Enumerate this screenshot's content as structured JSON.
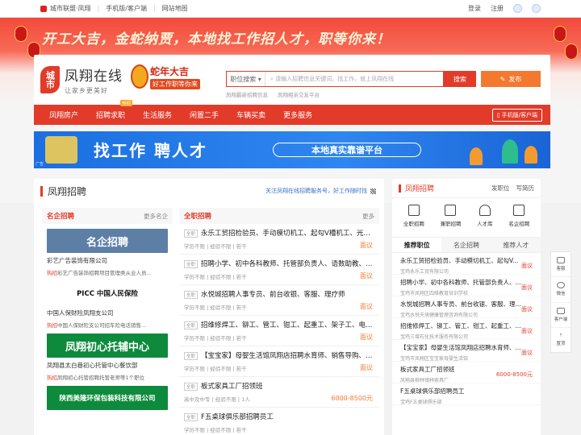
{
  "topbar": {
    "site_name": "城市联盟·凤翔",
    "mobile": "手机版/客户端",
    "sitemap": "网站地图",
    "login": "登录",
    "register": "注册"
  },
  "banner": {
    "slogan": "开工大吉，金蛇纳贾，本地找工作招人才，职等你来！"
  },
  "brand": {
    "badge": "城市",
    "name": "凤翔在线",
    "tagline": "让家乡更美好"
  },
  "snake": {
    "title": "蛇年大吉",
    "subtitle": "好工作职等你来"
  },
  "search": {
    "category": "职位搜索",
    "placeholder": "请输入招聘信息关键词，找工作，就上凤翔在线",
    "button": "搜索",
    "post_button": "发布",
    "hot": [
      "凤翔最新招聘信息",
      "凤翔相亲交友平台"
    ]
  },
  "nav": {
    "items": [
      "凤翔房产",
      "招聘求职",
      "生活服务",
      "闲置二手",
      "车辆买卖",
      "更多服务"
    ],
    "active_index": 1,
    "hot_tag": "热招",
    "mobile": "手机版/客户端"
  },
  "adbanner": {
    "headline": "找工作 聘人才",
    "pill": "本地真实靠谱平台",
    "ad_label": "广告"
  },
  "section": {
    "title": "凤翔招聘",
    "notice": "关注凤翔在线招聘服务号，好工作随时找"
  },
  "famous": {
    "head": "名企招聘",
    "more": "更多名企",
    "companies": [
      {
        "pic_text": "名企招聘",
        "name": "彩艺广告装饰有限公司",
        "hot": "热招",
        "desc": "彩艺广告装饰招聘项目管理类从业人员...",
        "bg": "#5d7fa6",
        "fg": "#ffffff"
      },
      {
        "pic_text": "PICC 中国人民保险",
        "name": "中国人保财险凤翔支公司",
        "hot": "热招",
        "desc": "中国人保财险支公司招车险电话销售...",
        "bg": "#ffffff",
        "fg": "#111111"
      },
      {
        "pic_text": "凤翔初心托辅中心",
        "name": "凤翔县太白巷初心托管中心餐饮部",
        "hot": "热招",
        "desc": "凤翔初心托管招聘托管老师等1个职位",
        "bg": "#0d8a3c",
        "fg": "#ffffff"
      },
      {
        "pic_text": "陕西美隆环保包装科技有限公司",
        "name": "",
        "hot": "",
        "desc": "",
        "bg": "#0d8a3c",
        "fg": "#ffffff"
      }
    ]
  },
  "jobs": {
    "head": "全职招聘",
    "more": "更多",
    "tag": "全职",
    "items": [
      {
        "title": "永乐工贸招检验员、手动模切机工、起勾V槽机工、光电定...",
        "meta": "学历不限 | 经验不限 | 若干",
        "salary": "面议"
      },
      {
        "title": "招聘小学、初中各科教师、托管部负责人、语数助教、行政...",
        "meta": "学历不限 | 经验不限 | 若干",
        "salary": "面议"
      },
      {
        "title": "水悦城招聘人事专员、前台收银、客服、理疗师",
        "meta": "学历不限 | 经验不限 | 若干",
        "salary": "面议"
      },
      {
        "title": "招维修焊工、铆工、管工、钳工、起重工、架子工、电工、...",
        "meta": "学历不限 | 经验不限 | 若干",
        "salary": "面议"
      },
      {
        "title": "【宝宝家】母婴生活馆凤翔店招聘水育师、销售导购、产后...",
        "meta": "学历不限 | 经验不限 | 若干",
        "salary": "面议"
      },
      {
        "title": "板式家具工厂招领班",
        "meta": "高中及中专 | 经验不限 | 1人",
        "salary": "6000-8500元"
      },
      {
        "title": "F五桌球俱乐部招聘员工",
        "meta": "学历不限 | 经验不限 | 若干",
        "salary": ""
      }
    ]
  },
  "right": {
    "title": "凤翔招聘",
    "links": [
      "发职位",
      "写简历"
    ],
    "icons": [
      {
        "label": "全职招聘",
        "icon": "briefcase-icon"
      },
      {
        "label": "兼职招聘",
        "icon": "clipboard-icon"
      },
      {
        "label": "人才库",
        "icon": "graduation-cap-icon"
      },
      {
        "label": "名企招聘",
        "icon": "building-icon"
      }
    ],
    "tabs": [
      "推荐职位",
      "名企招聘",
      "推荐人才"
    ],
    "jobs": [
      {
        "title": "永乐工贸招检验员、手动模切机工、起勾V...",
        "company": "宝鸡永乐工贸有限公司",
        "salary": "面议"
      },
      {
        "title": "招聘小学、初中各科教师、托管部负责人、...",
        "company": "宝鸡市凤翔区四维教育培训学校",
        "salary": "面议"
      },
      {
        "title": "水悦城招聘人事专员、前台收银、客服、理...",
        "company": "宝鸡水悦天境健康管理咨询有限公司",
        "salary": "面议"
      },
      {
        "title": "招维修焊工、铆工、管工、钳工、起重工、...",
        "company": "宝鸡三增石化技术服务有限公司",
        "salary": "面议"
      },
      {
        "title": "【宝宝家】母婴生活馆凤翔店招聘水育师、...",
        "company": "宝鸡市凤翔区宝宝家母婴生活馆",
        "salary": "面议"
      },
      {
        "title": "板式家具工厂招领班",
        "company": "凤翔县柳林镇林家具厂",
        "salary": "6000-8500元"
      },
      {
        "title": "F五桌球俱乐部招聘员工",
        "company": "宝鸡F五桌球俱乐部",
        "salary": ""
      }
    ]
  },
  "float": [
    "客服",
    "微信",
    "客户端",
    "置顶"
  ],
  "colors": {
    "brand_red": "#e23b2a",
    "accent_orange": "#f5782f",
    "banner_blue": "#1b6fe0"
  }
}
